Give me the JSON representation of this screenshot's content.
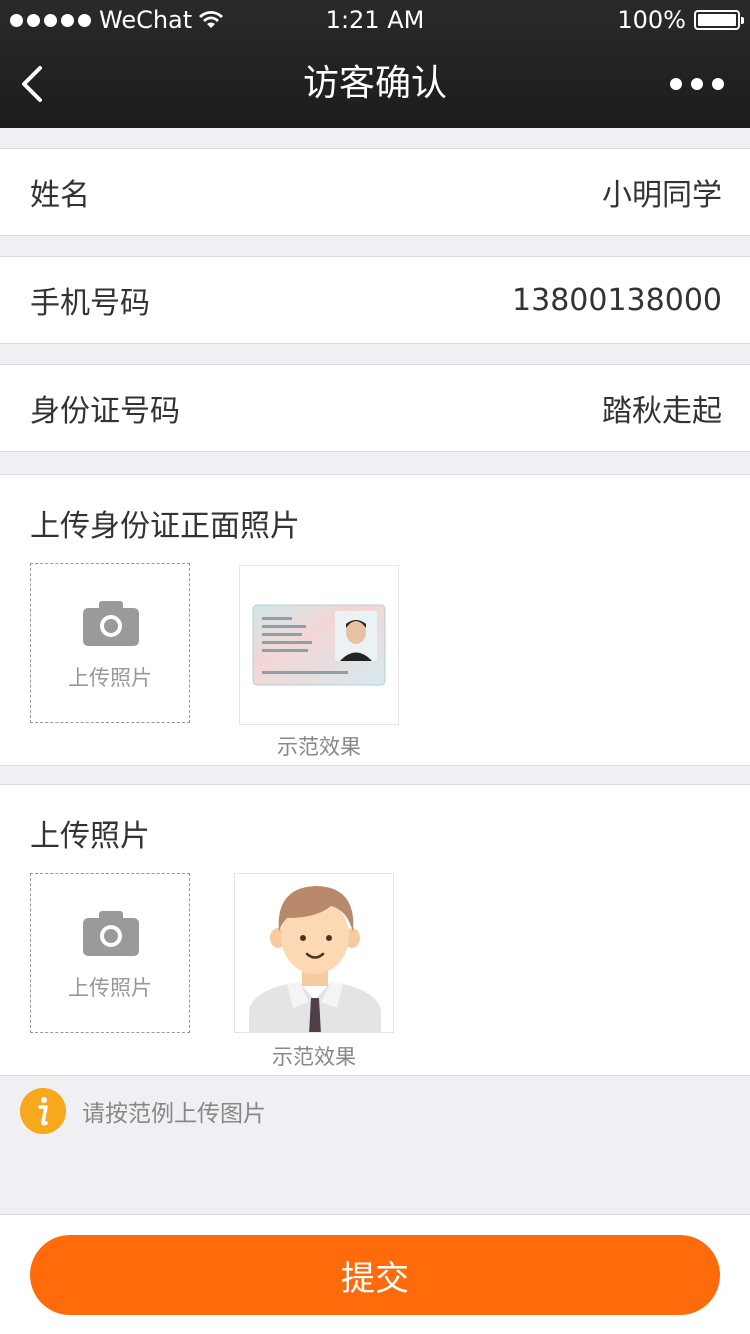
{
  "status_bar": {
    "carrier": "WeChat",
    "time": "1:21 AM",
    "battery": "100%",
    "battery_level": 1.0
  },
  "nav": {
    "title": "访客确认",
    "back_icon": "chevron-left-icon",
    "more_icon": "more-dots-icon"
  },
  "fields": [
    {
      "label": "姓名",
      "value": "小明同学"
    },
    {
      "label": "手机号码",
      "value": "13800138000"
    },
    {
      "label": "身份证号码",
      "value": "踏秋走起"
    }
  ],
  "id_section": {
    "title": "上传身份证正面照片",
    "upload_label": "上传照片",
    "sample_caption": "示范效果"
  },
  "photo_section": {
    "title": "上传照片",
    "upload_label": "上传照片",
    "sample_caption": "示范效果"
  },
  "tip": {
    "text": "请按范例上传图片",
    "icon": "info-icon"
  },
  "submit_label": "提交",
  "colors": {
    "accent": "#ff6a0b",
    "tip_icon": "#f7a81d",
    "nav_bg": "#1f1f1f",
    "page_bg": "#efeff4"
  }
}
